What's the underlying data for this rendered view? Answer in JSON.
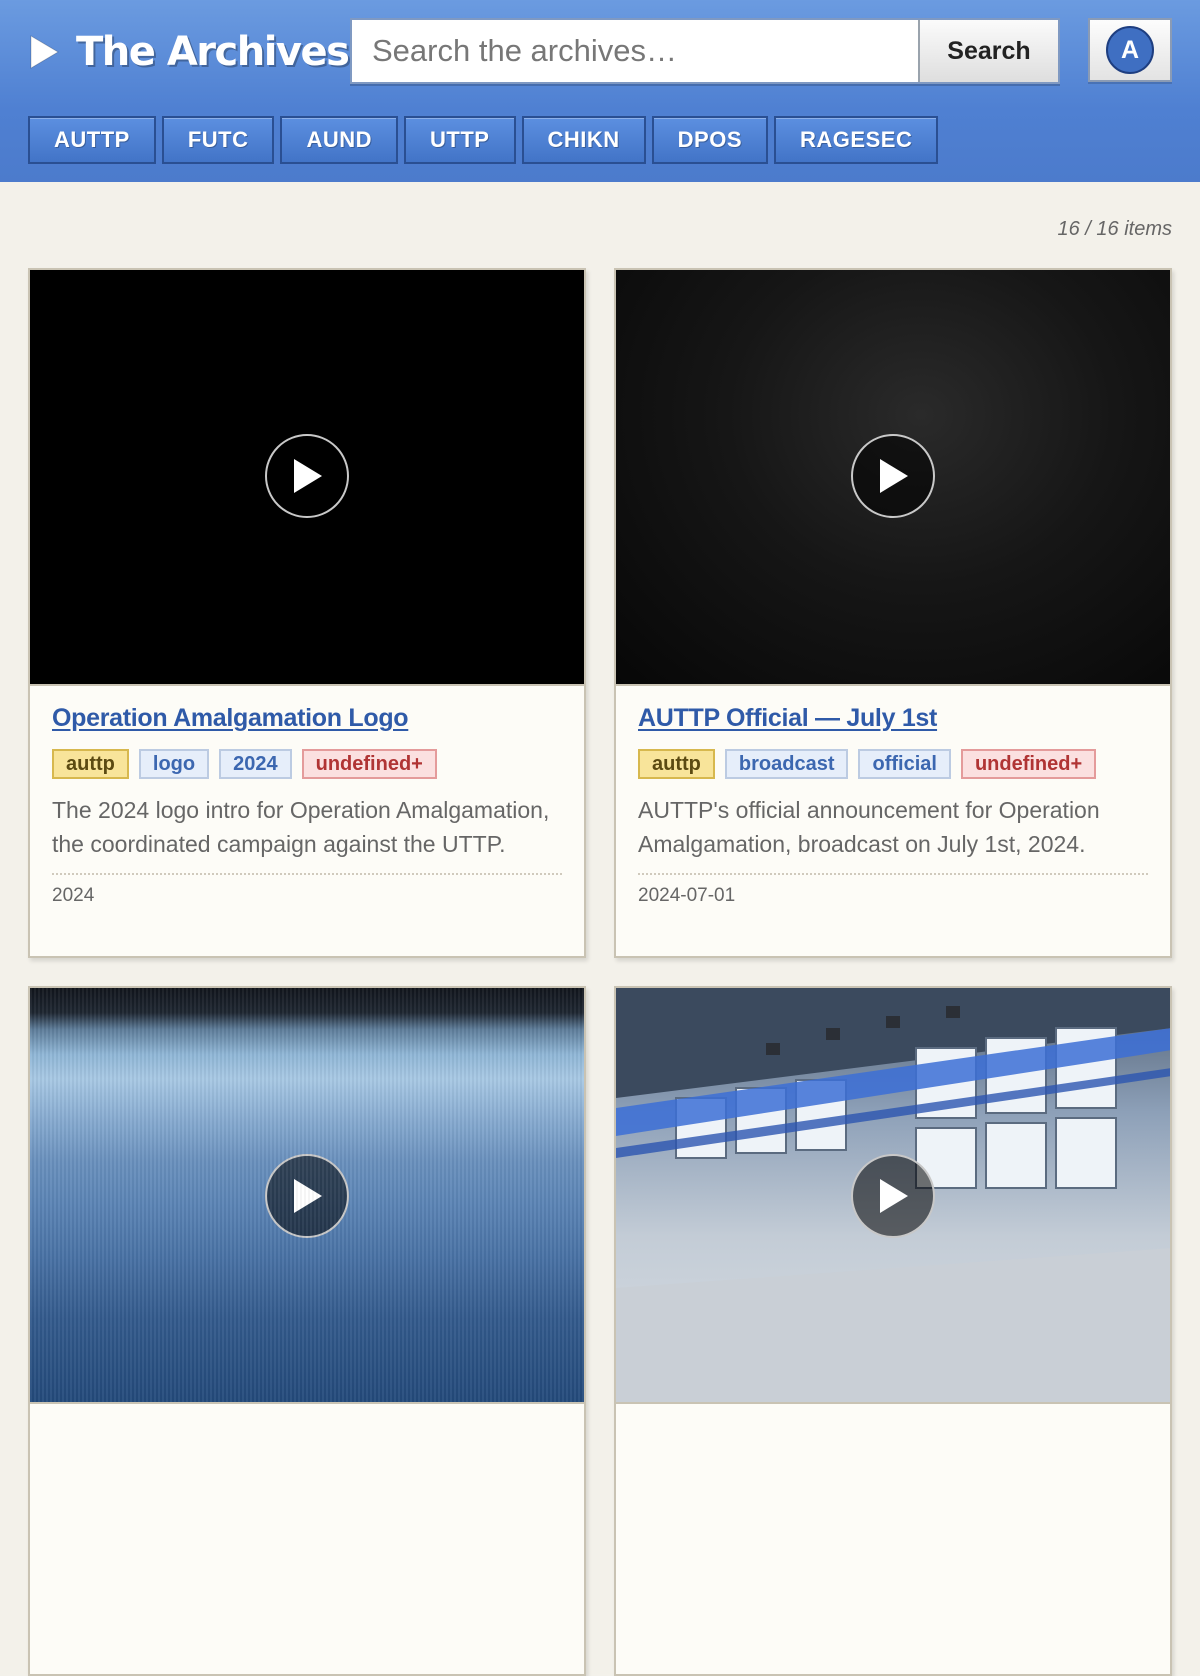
{
  "header": {
    "logo_text": "The Archives",
    "search_placeholder": "Search the archives…",
    "search_value": "",
    "search_button": "Search",
    "account_initial": "A"
  },
  "categories": [
    "AUTTP",
    "FUTC",
    "AUND",
    "UTTP",
    "CHIKN",
    "DPOS",
    "RAGESEC"
  ],
  "main": {
    "item_count": "16 / 16 items"
  },
  "cards": [
    {
      "title": "Operation Amalgamation Logo",
      "tags": [
        {
          "label": "auttp",
          "style": "primary"
        },
        {
          "label": "logo",
          "style": "normal"
        },
        {
          "label": "2024",
          "style": "normal"
        },
        {
          "label": "undefined+",
          "style": "more"
        }
      ],
      "description": "The 2024 logo intro for Operation Amalgamation, the coordinated campaign against the UTTP.",
      "date": "2024"
    },
    {
      "title": "AUTTP Official — July 1st",
      "tags": [
        {
          "label": "auttp",
          "style": "primary"
        },
        {
          "label": "broadcast",
          "style": "normal"
        },
        {
          "label": "official",
          "style": "normal"
        },
        {
          "label": "undefined+",
          "style": "more"
        }
      ],
      "description": "AUTTP's official announcement for Operation Amalgamation, broadcast on July 1st, 2024.",
      "date": "2024-07-01"
    }
  ],
  "colors": {
    "header_top": "#6b9be0",
    "header_bottom": "#4c7bcc",
    "link": "#2f5aa8",
    "page_bg": "#f3f1ea"
  },
  "icons": {
    "logo": "play-triangle-icon",
    "play": "play-icon"
  }
}
